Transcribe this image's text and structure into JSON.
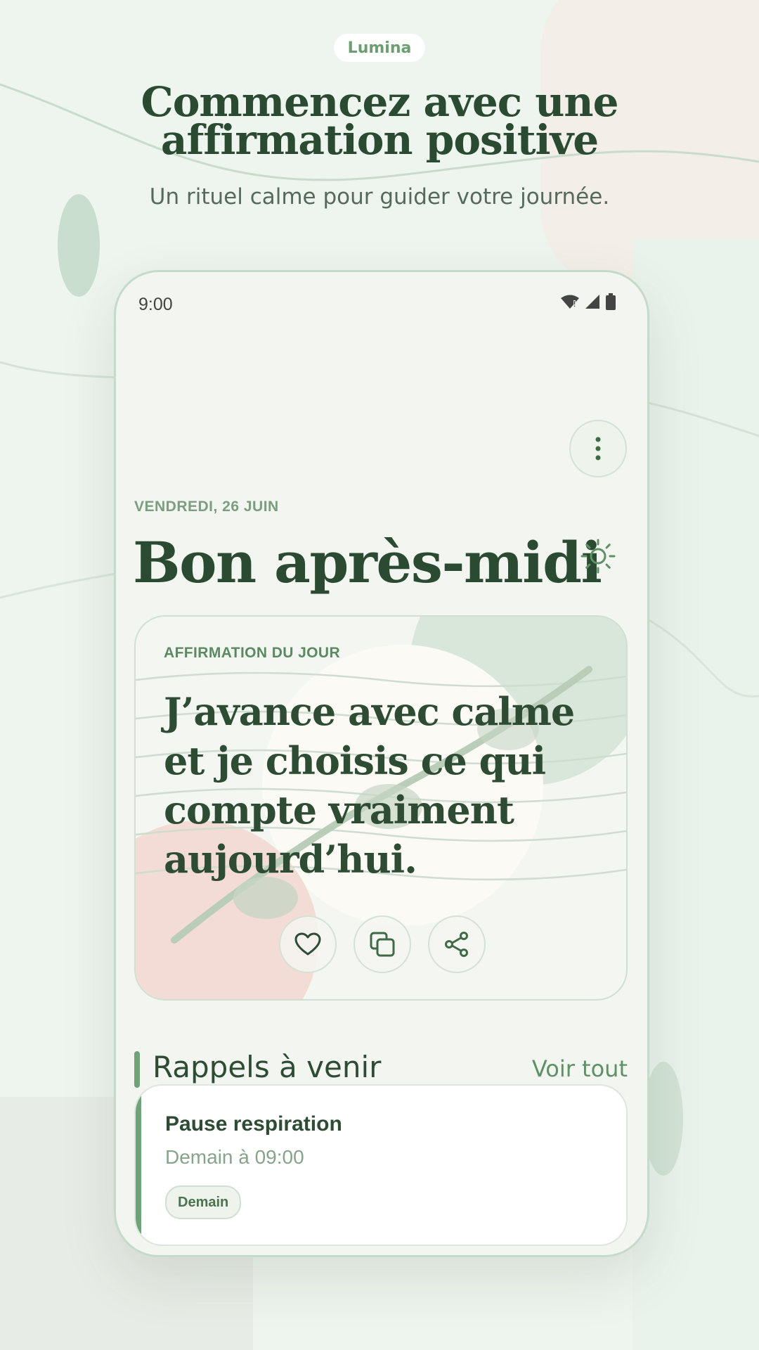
{
  "brand": {
    "name": "Lumina"
  },
  "hero": {
    "title_line1": "Commencez avec une",
    "title_line2": "affirmation positive",
    "subtitle": "Un rituel calme pour guider votre journée."
  },
  "phone": {
    "status": {
      "time": "9:00",
      "icons": [
        "wifi-icon",
        "signal-icon",
        "battery-icon"
      ]
    },
    "menu_icon": "more-vertical-icon",
    "date": "VENDREDI, 26 JUIN",
    "greeting": "Bon après-midi",
    "greeting_icon": "sun-icon",
    "affirmation": {
      "label": "AFFIRMATION DU JOUR",
      "text": "J’avance avec calme et je choisis ce qui compte vraiment aujourd’hui.",
      "actions": [
        "heart-icon",
        "copy-icon",
        "share-icon"
      ]
    },
    "reminders": {
      "title": "Rappels à venir",
      "see_all": "Voir tout",
      "items": [
        {
          "name": "Pause respiration",
          "time": "Demain à 09:00",
          "chip": "Demain"
        }
      ]
    }
  },
  "colors": {
    "accent": "#6fa276",
    "heading": "#2a4a31",
    "background": "#eef4ee"
  }
}
